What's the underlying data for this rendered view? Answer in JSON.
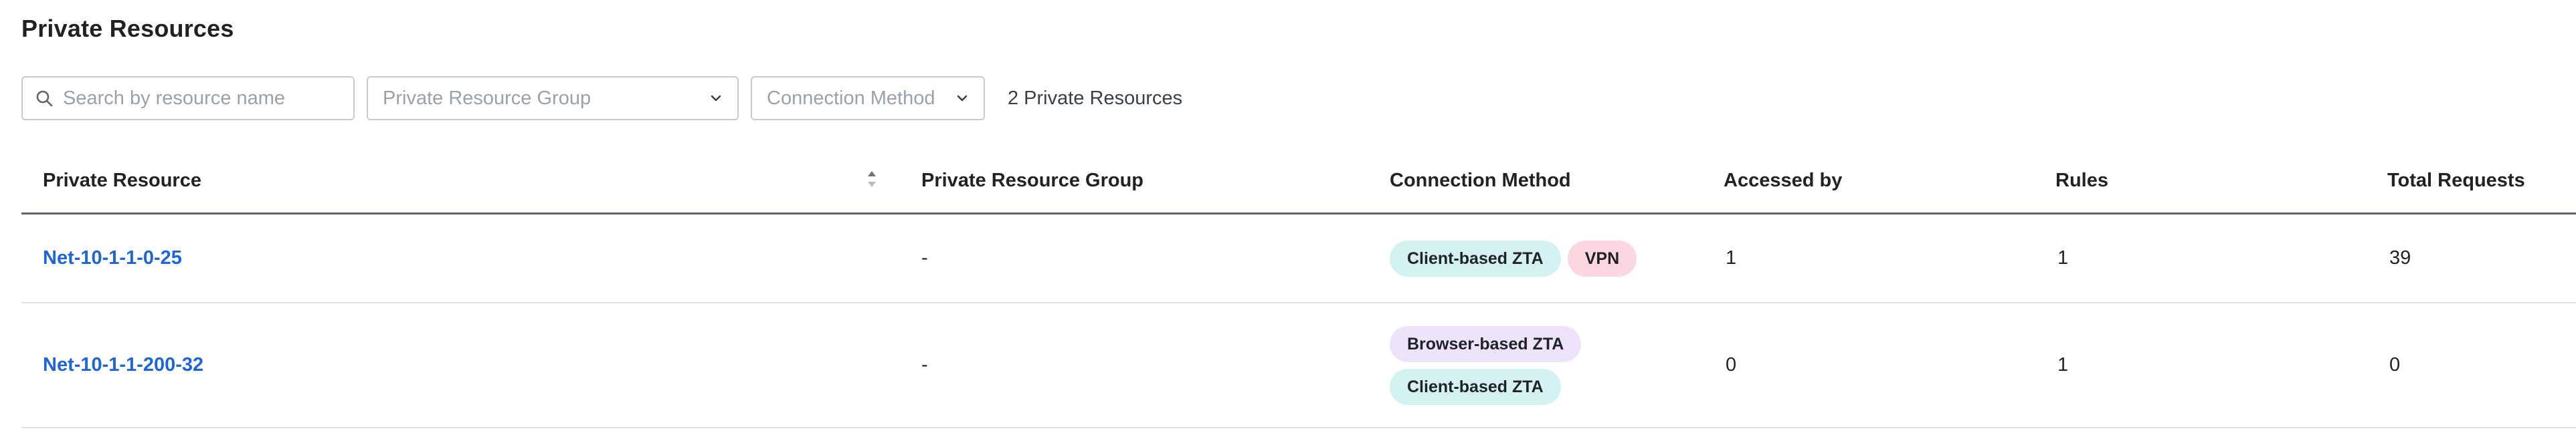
{
  "page": {
    "title": "Private Resources"
  },
  "filters": {
    "search_placeholder": "Search by resource name",
    "group_placeholder": "Private Resource Group",
    "method_placeholder": "Connection Method",
    "result_count": "2 Private Resources"
  },
  "table": {
    "columns": [
      "Private Resource",
      "Private Resource Group",
      "Connection Method",
      "Accessed by",
      "Rules",
      "Total Requests"
    ],
    "sorted_column": "Private Resource",
    "rows": [
      {
        "name": "Net-10-1-1-0-25",
        "group": "-",
        "methods": [
          "Client-based ZTA",
          "VPN"
        ],
        "accessed_by": "1",
        "rules": "1",
        "total_requests": "39"
      },
      {
        "name": "Net-10-1-1-200-32",
        "group": "-",
        "methods": [
          "Browser-based ZTA",
          "Client-based ZTA"
        ],
        "accessed_by": "0",
        "rules": "1",
        "total_requests": "0"
      }
    ]
  },
  "badge_colors": {
    "Client-based ZTA": "#d3f2f1",
    "VPN": "#fcd6e0",
    "Browser-based ZTA": "#ede4fb"
  },
  "icons": {
    "search": "search-icon",
    "dropdown": "chevron-down-icon",
    "sort": "sort-icon"
  }
}
